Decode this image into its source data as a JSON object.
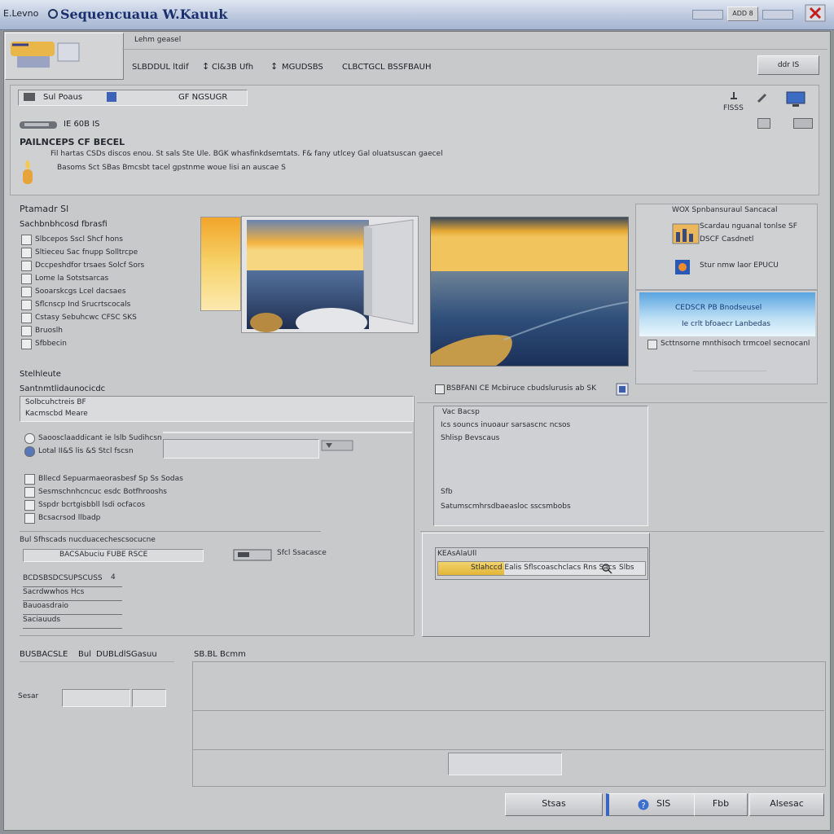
{
  "window": {
    "title_prefix": "E.Levno",
    "title": "Sequencuaua W.Kauuk",
    "ctrl_label": "ADD 8",
    "tab_label": "Lehm geasel"
  },
  "toolbar": {
    "items": [
      "SLBDDUL ltdif",
      "Cl&3B Ufh",
      "MGUDSBS",
      "CLBCTGCL BSSFBAUH"
    ],
    "right_button": "ddr IS"
  },
  "info": {
    "combo_label": "Sul Poaus",
    "combo_value": "GF NGSUGR",
    "version": "IE 60B IS",
    "right_count": "FlSSS",
    "heading": "PAILNCEPS CF BECEL",
    "desc_line1": "Fil hartas CSDs discos enou. St sals Ste Ule. BGK whasfinkdsemtats. F& fany utlcey Gal oluatsuscan gaecel",
    "desc_line2": "Basoms Sct SBas Bmcsbt tacel gpstnme woue lisi an auscae S"
  },
  "media": {
    "section_title": "Ptamadr Sl",
    "group_title": "Sachbnbhcosd fbrasfi",
    "items": [
      "Slbcepos Sscl Shcf hons",
      "Sltieceu Sac fnupp Solltrcpe",
      "Dccpeshdfor trsaes Solcf Sors",
      "Lome la Sotstsarcas",
      "Sooarskcgs Lcel dacsaes",
      "Sflcnscp Ind Srucrtscocals",
      "Cstasy Sebuhcwc CFSC SKS",
      "Bruoslh",
      "Sfbbecin"
    ]
  },
  "side_panel": {
    "title": "WOX Spnbansuraul Sancacal",
    "row1_a": "Scardau nguanal tonlse SF",
    "row1_b": "DSCF Casdnetl",
    "row2": "Stur nmw laor EPUCU",
    "banner_line1": "CEDSCR PB Bnodseusel",
    "banner_line2": "Ie crlt bfoaecr Lanbedas",
    "footer": "Scttnsorne mnthisoch trmcoel secnocanl"
  },
  "settings": {
    "section": "Stelhleute",
    "header": "Santnmtlidaunocicdc",
    "field1_label": "Solbcuhctreis BF",
    "field1_value": "Kacmscbd Meare",
    "radio1": "Saoosclaaddicant ie lslb Sudihcsn",
    "radio2": "Lotal II&S lis &S Stcl fscsn",
    "checks": [
      "Bllecd Sepuarmaeorasbesf Sp Ss Sodas",
      "Sesmschnhcncuc esdc Botfhrooshs",
      "Sspdr bcrtgisbbll lsdi ocfacos",
      "Bcsacrsod llbadp"
    ],
    "list_title": "Bul Sfhscads nucduacechescsocucne",
    "list_combo": "BACSAbuciu FUBE RSCE",
    "list_items": [
      "BCDSBSDCSUPSCUSS",
      "Sacrdwwhos Hcs",
      "Bauoasdraio",
      "Saciauuds"
    ],
    "list_badge": "4",
    "aside_value": "Sfcl Ssacasce"
  },
  "right": {
    "dropdown_label": "BSBFANI CE Mcbiruce cbudslurusis ab SK",
    "box_title": "Vac Bacsp",
    "box_line1": "Ics souncs inuoaur sarsascnc ncsos",
    "box_line2": "Shlisp Bevscaus",
    "box_tag": "Sfb",
    "box_line3": "Satumscmhrsdbaeasloc sscsmbobs",
    "status_title": "KEAsAlaUll",
    "status_bar_text": "Stlahccd Ealis Sflscoaschclacs Rns Sacs",
    "status_right": "Slbs",
    "progress": 0.32
  },
  "bottom": {
    "label_left": "BUSBACSLE",
    "label_mid": "Bul",
    "label_right": "DUBLdlSGasuu",
    "field_label": "Sesar",
    "group_title": "SB.BL Bcmm"
  },
  "footer_buttons": {
    "ok": "Stsas",
    "help": "SIS",
    "apply": "Fbb",
    "cancel": "Alsesac"
  }
}
